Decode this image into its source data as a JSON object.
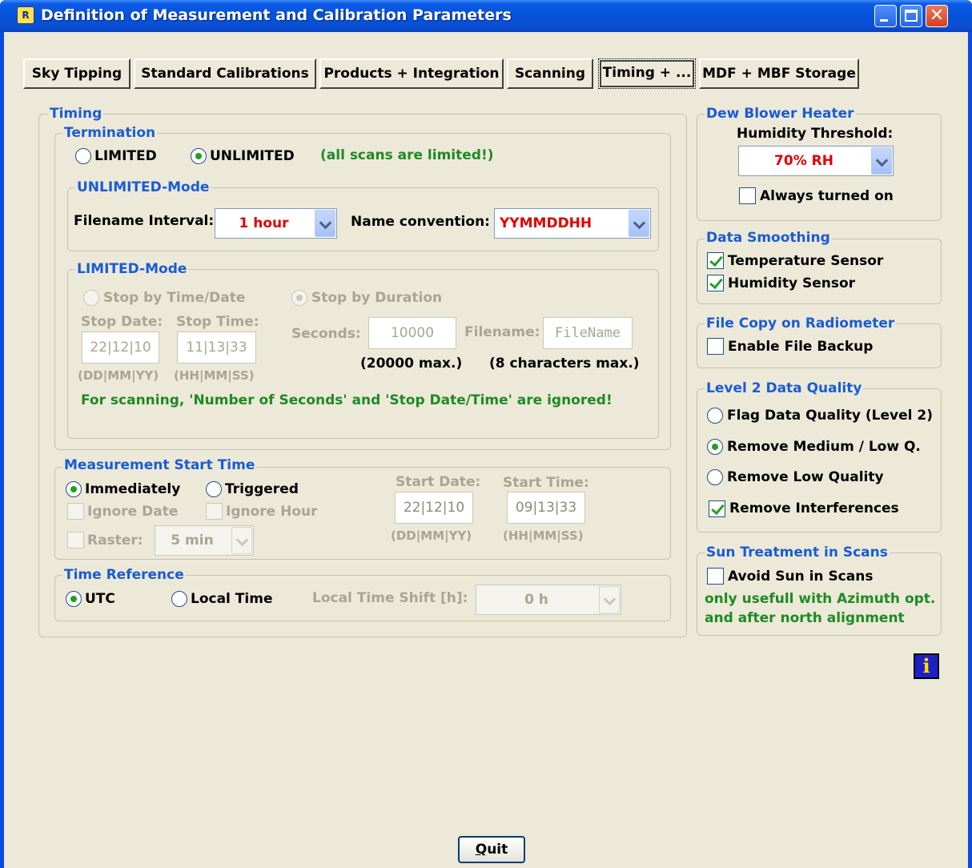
{
  "window": {
    "title": "Definition of Measurement and Calibration Parameters",
    "app_icon": "R"
  },
  "tabs": [
    "Sky Tipping",
    "Standard Calibrations",
    "Products + Integration",
    "Scanning",
    "Timing + ...",
    "MDF + MBF Storage"
  ],
  "active_tab": "Timing + ...",
  "timing": {
    "title": "Timing",
    "termination": {
      "title": "Termination",
      "limited": "LIMITED",
      "unlimited": "UNLIMITED",
      "note": "(all scans are limited!)",
      "selected": "UNLIMITED"
    },
    "unlimited_mode": {
      "title": "UNLIMITED-Mode",
      "filename_interval_label": "Filename Interval:",
      "filename_interval": "1 hour",
      "name_convention_label": "Name convention:",
      "name_convention": "YYMMDDHH"
    },
    "limited_mode": {
      "title": "LIMITED-Mode",
      "stop_by_time": "Stop by Time/Date",
      "stop_by_duration": "Stop by Duration",
      "stop_date_label": "Stop Date:",
      "stop_date": "22|12|10",
      "stop_date_format": "(DD|MM|YY)",
      "stop_time_label": "Stop Time:",
      "stop_time": "11|13|33",
      "stop_time_format": "(HH|MM|SS)",
      "seconds_label": "Seconds:",
      "seconds": "10000",
      "seconds_max": "(20000 max.)",
      "filename_label": "Filename:",
      "filename": "FileName",
      "filename_max": "(8 characters max.)",
      "scan_note": "For scanning, 'Number of Seconds' and 'Stop Date/Time' are ignored!"
    },
    "start_time": {
      "title": "Measurement Start Time",
      "immediately": "Immediately",
      "triggered": "Triggered",
      "ignore_date": "Ignore Date",
      "ignore_hour": "Ignore Hour",
      "raster_label": "Raster:",
      "raster": "5 min",
      "start_date_label": "Start Date:",
      "start_date": "22|12|10",
      "start_date_format": "(DD|MM|YY)",
      "start_time_label": "Start Time:",
      "start_time": "09|13|33",
      "start_time_format": "(HH|MM|SS)"
    },
    "time_reference": {
      "title": "Time Reference",
      "utc": "UTC",
      "local": "Local Time",
      "shift_label": "Local Time Shift [h]:",
      "shift": "0 h"
    }
  },
  "dew_blower": {
    "title": "Dew Blower Heater",
    "threshold_label": "Humidity Threshold:",
    "threshold": "70% RH",
    "always_on": "Always turned on"
  },
  "smoothing": {
    "title": "Data Smoothing",
    "temperature": "Temperature Sensor",
    "humidity": "Humidity Sensor"
  },
  "file_copy": {
    "title": "File Copy on Radiometer",
    "backup": "Enable File Backup"
  },
  "level2": {
    "title": "Level 2 Data Quality",
    "flag": "Flag Data Quality (Level 2)",
    "remove_med_low": "Remove Medium / Low Q.",
    "remove_low": "Remove Low Quality",
    "remove_interf": "Remove Interferences"
  },
  "sun": {
    "title": "Sun Treatment in Scans",
    "avoid": "Avoid Sun in Scans",
    "note1": "only usefull with Azimuth opt.",
    "note2": "and after north alignment"
  },
  "info_icon": "i",
  "quit": {
    "accel": "Q",
    "rest": "uit"
  }
}
